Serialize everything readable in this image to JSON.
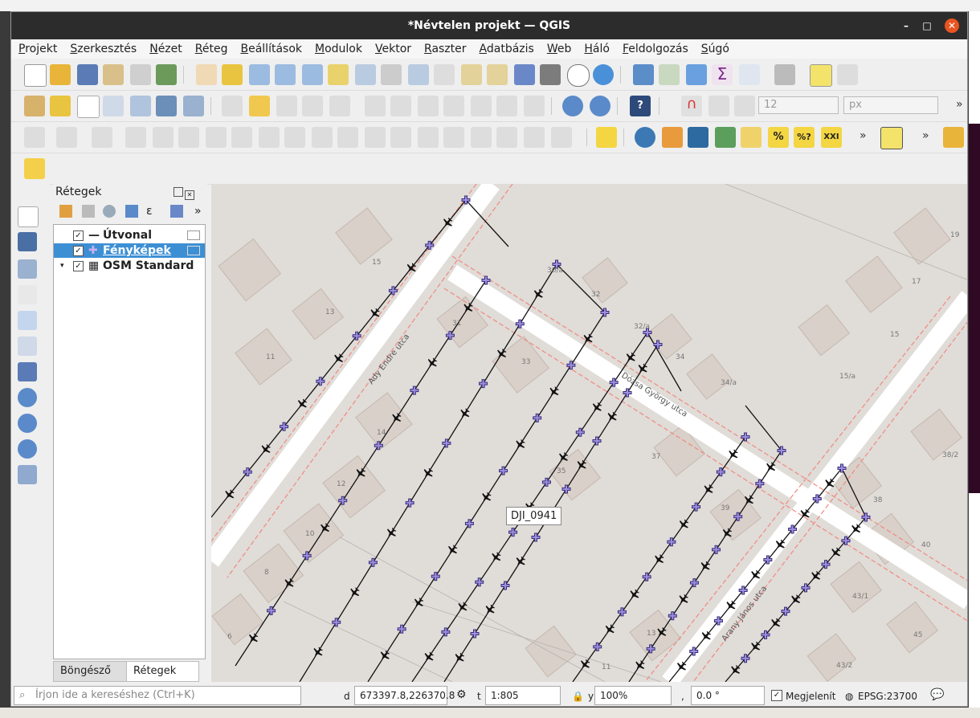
{
  "window": {
    "title": "*Névtelen projekt — QGIS"
  },
  "menu": [
    "Projekt",
    "Szerkesztés",
    "Nézet",
    "Réteg",
    "Beállítások",
    "Modulok",
    "Vektor",
    "Raszter",
    "Adatbázis",
    "Web",
    "Háló",
    "Feldolgozás",
    "Súgó"
  ],
  "toolbar": {
    "font_size_value": "12",
    "font_unit": "px"
  },
  "layers_panel": {
    "title": "Rétegek",
    "layers": [
      {
        "name": "Útvonal",
        "checked": true
      },
      {
        "name": "Fényképek",
        "checked": true,
        "selected": true
      },
      {
        "name": "OSM Standard",
        "checked": true
      }
    ],
    "tabs": [
      "Böngésző",
      "Rétegek"
    ]
  },
  "map": {
    "tooltip": "DJI_0941",
    "street_labels": [
      "Ady Endre utca",
      "Dózsa György utca",
      "Arany János utca"
    ],
    "house_numbers": [
      "15",
      "13",
      "11",
      "31",
      "30/a",
      "32",
      "32/a",
      "33",
      "34",
      "34/a",
      "14",
      "12",
      "10",
      "8",
      "6",
      "35",
      "37",
      "39",
      "38",
      "40",
      "43/1",
      "45",
      "43/2",
      "38/2",
      "17",
      "19",
      "15",
      "15/a",
      "13",
      "11"
    ]
  },
  "status": {
    "search_placeholder": "Írjon ide a kereséshez (Ctrl+K)",
    "coordinate": "673397.8,226370.8",
    "scale": "1:805",
    "magnifier": "100%",
    "rotation": "0.0 °",
    "render_label": "Megjelenít",
    "crs": "EPSG:23700"
  }
}
